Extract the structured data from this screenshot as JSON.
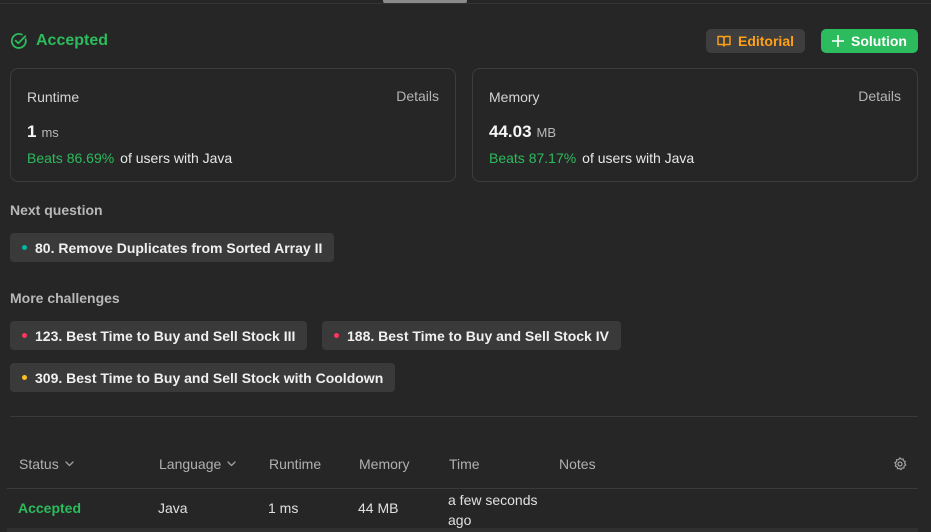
{
  "header": {
    "status": "Accepted",
    "editorial_label": "Editorial",
    "solution_label": "Solution",
    "colors": {
      "accepted": "#2cbb5d",
      "editorial": "#ffa116"
    }
  },
  "runtime_card": {
    "label": "Runtime",
    "details": "Details",
    "value": "1",
    "unit": "ms",
    "beats": "Beats 86.69%",
    "rest": "of users with Java"
  },
  "memory_card": {
    "label": "Memory",
    "details": "Details",
    "value": "44.03",
    "unit": "MB",
    "beats": "Beats 87.17%",
    "rest": "of users with Java"
  },
  "next_question": {
    "label": "Next question",
    "items": [
      {
        "title": "80. Remove Duplicates from Sorted Array II",
        "difficulty_color": "#00b8a3"
      }
    ]
  },
  "more_challenges": {
    "label": "More challenges",
    "items": [
      {
        "title": "123. Best Time to Buy and Sell Stock III",
        "difficulty_color": "#ff375f"
      },
      {
        "title": "188. Best Time to Buy and Sell Stock IV",
        "difficulty_color": "#ff375f"
      },
      {
        "title": "309. Best Time to Buy and Sell Stock with Cooldown",
        "difficulty_color": "#ffc01e"
      }
    ]
  },
  "table": {
    "headers": [
      "Status",
      "Language",
      "Runtime",
      "Memory",
      "Time",
      "Notes"
    ],
    "rows": [
      {
        "status": "Accepted",
        "language": "Java",
        "runtime": "1 ms",
        "memory": "44 MB",
        "time": "a few seconds ago",
        "notes": ""
      }
    ]
  }
}
